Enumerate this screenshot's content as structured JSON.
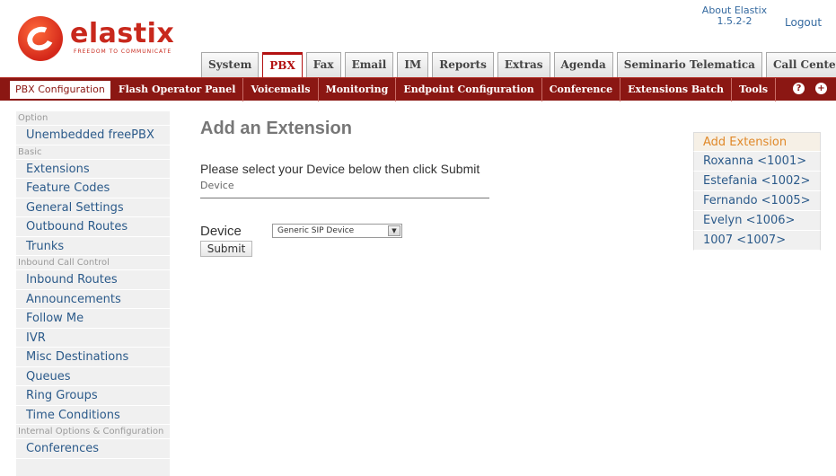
{
  "brand": {
    "name": "elastix",
    "tagline": "FREEDOM TO COMMUNICATE"
  },
  "header": {
    "about_line1": "About Elastix",
    "about_line2": "1.5.2-2",
    "logout": "Logout"
  },
  "tabs": [
    {
      "label": "System",
      "active": false
    },
    {
      "label": "PBX",
      "active": true
    },
    {
      "label": "Fax",
      "active": false
    },
    {
      "label": "Email",
      "active": false
    },
    {
      "label": "IM",
      "active": false
    },
    {
      "label": "Reports",
      "active": false
    },
    {
      "label": "Extras",
      "active": false
    },
    {
      "label": "Agenda",
      "active": false
    },
    {
      "label": "Seminario Telematica",
      "active": false
    },
    {
      "label": "Call Center",
      "active": false
    }
  ],
  "menu": [
    "PBX Configuration",
    "Flash Operator Panel",
    "Voicemails",
    "Monitoring",
    "Endpoint Configuration",
    "Conference",
    "Extensions Batch",
    "Tools"
  ],
  "menu_icons": {
    "help": "?",
    "plus": "+"
  },
  "sidebar": {
    "sections": [
      {
        "title": "Option",
        "items": [
          "Unembedded freePBX"
        ]
      },
      {
        "title": "Basic",
        "items": [
          "Extensions",
          "Feature Codes",
          "General Settings",
          "Outbound Routes",
          "Trunks"
        ]
      },
      {
        "title": "Inbound Call Control",
        "items": [
          "Inbound Routes",
          "Announcements",
          "Follow Me",
          "IVR",
          "Misc Destinations",
          "Queues",
          "Ring Groups",
          "Time Conditions"
        ]
      },
      {
        "title": "Internal Options & Configuration",
        "items": [
          "Conferences"
        ]
      }
    ]
  },
  "main": {
    "title": "Add an Extension",
    "instruction": "Please select your Device below then click Submit",
    "device_heading": "Device",
    "device_label": "Device",
    "device_selected": "Generic SIP Device",
    "submit_label": "Submit"
  },
  "extensions_list": [
    {
      "label": "Add Extension",
      "current": true
    },
    {
      "label": "Roxanna <1001>",
      "current": false
    },
    {
      "label": "Estefania <1002>",
      "current": false
    },
    {
      "label": "Fernando <1005>",
      "current": false
    },
    {
      "label": "Evelyn <1006>",
      "current": false
    },
    {
      "label": "1007 <1007>",
      "current": false
    }
  ],
  "colors": {
    "brand_red": "#c8281c",
    "menubar": "#8b1713",
    "link_blue": "#2b5a8a",
    "current_orange": "#e0892a"
  }
}
